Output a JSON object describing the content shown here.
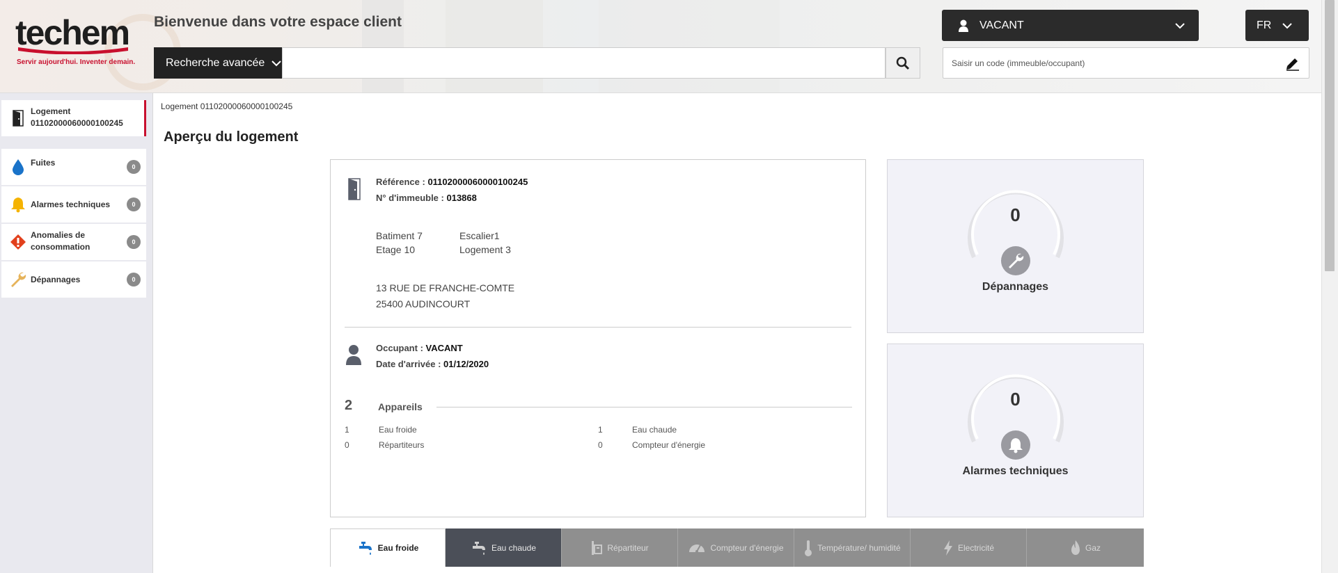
{
  "header": {
    "logo_text": "techem",
    "logo_tagline": "Servir aujourd'hui. Inventer demain.",
    "welcome": "Bienvenue dans votre espace client",
    "advanced_search_label": "Recherche avancée",
    "search_value": "",
    "user_label": "VACANT",
    "language_label": "FR",
    "code_placeholder": "Saisir un code (immeuble/occupant)"
  },
  "sidebar": {
    "items": [
      {
        "label": "Logement\n01102000060000100245",
        "icon": "door-icon",
        "badge": ""
      },
      {
        "label": "Fuites",
        "icon": "water-drop-icon",
        "badge": "0"
      },
      {
        "label": "Alarmes techniques",
        "icon": "bell-icon",
        "badge": "0"
      },
      {
        "label": "Anomalies de\nconsommation",
        "icon": "warning-icon",
        "badge": "0"
      },
      {
        "label": "Dépannages",
        "icon": "wrench-icon",
        "badge": "0"
      }
    ]
  },
  "breadcrumb": "Logement 01102000060000100245",
  "page_title": "Aperçu du logement",
  "info": {
    "reference_label": "Référence :",
    "reference_value": "01102000060000100245",
    "immeuble_label": "N° d'immeuble :",
    "immeuble_value": "013868",
    "batiment": "Batiment 7",
    "escalier": "Escalier1",
    "etage": "Etage 10",
    "logement": "Logement 3",
    "address_line1": "13 RUE DE FRANCHE-COMTE",
    "address_line2": "25400 AUDINCOURT",
    "occupant_label": "Occupant :",
    "occupant_value": "VACANT",
    "arrival_label": "Date d'arrivée :",
    "arrival_value": "01/12/2020",
    "devices_count": "2",
    "devices_title": "Appareils",
    "devices": [
      {
        "count": "1",
        "name": "Eau froide"
      },
      {
        "count": "1",
        "name": "Eau chaude"
      },
      {
        "count": "0",
        "name": "Répartiteurs"
      },
      {
        "count": "0",
        "name": "Compteur d'énergie"
      }
    ]
  },
  "stats": [
    {
      "value": "0",
      "label": "Dépannages",
      "icon": "wrench-icon"
    },
    {
      "value": "0",
      "label": "Alarmes techniques",
      "icon": "bell-icon"
    }
  ],
  "tabs": [
    {
      "label": "Eau froide",
      "icon": "faucet-icon",
      "state": "active"
    },
    {
      "label": "Eau chaude",
      "icon": "faucet-icon",
      "state": "dark"
    },
    {
      "label": "Répartiteur",
      "icon": "radiator-icon",
      "state": "inactive"
    },
    {
      "label": "Compteur d'énergie",
      "icon": "gauge-icon",
      "state": "inactive"
    },
    {
      "label": "Température/ humidité",
      "icon": "thermometer-icon",
      "state": "inactive"
    },
    {
      "label": "Electricité",
      "icon": "lightning-icon",
      "state": "inactive"
    },
    {
      "label": "Gaz",
      "icon": "flame-icon",
      "state": "inactive"
    }
  ],
  "colors": {
    "brand_red": "#c8102e",
    "dark_button": "#2b2b2b",
    "tab_inactive": "#8f8f8f",
    "tab_dark": "#4b4f58",
    "water_blue": "#1a73c9",
    "bell_yellow": "#f5b301",
    "warning_red": "#e2401c",
    "wrench_tan": "#e6b35a"
  }
}
